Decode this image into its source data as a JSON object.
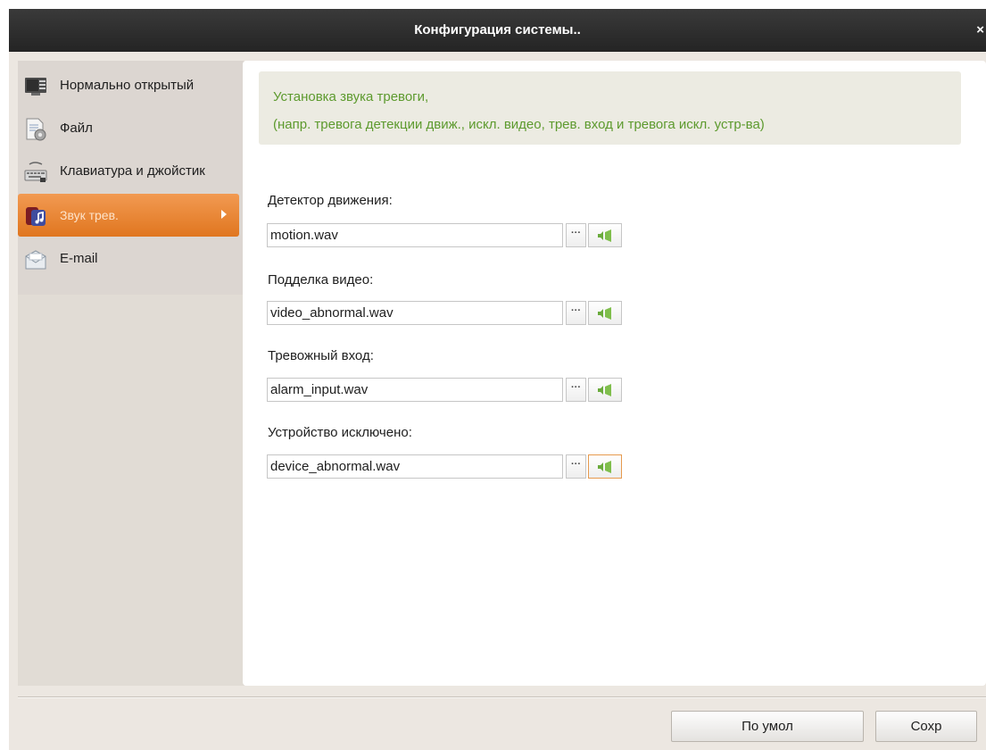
{
  "window": {
    "title": "Конфигурация системы..",
    "close_label": "×"
  },
  "sidebar": {
    "items": [
      {
        "label": "Нормально открытый",
        "icon": "monitor-icon",
        "active": false
      },
      {
        "label": "Файл",
        "icon": "file-settings-icon",
        "active": false
      },
      {
        "label": "Клавиатура и джойстик",
        "icon": "keyboard-icon",
        "active": false
      },
      {
        "label": "Звук трев.",
        "icon": "alarm-sound-icon",
        "active": true
      },
      {
        "label": "E-mail",
        "icon": "email-icon",
        "active": false
      }
    ]
  },
  "main": {
    "notice": {
      "line1": "Установка звука тревоги,",
      "line2": "(напр. тревога детекции движ., искл. видео, трев. вход и тревога искл. устр-ва)"
    },
    "fields": [
      {
        "label": "Детектор движения:",
        "value": "motion.wav"
      },
      {
        "label": "Подделка видео:",
        "value": "video_abnormal.wav"
      },
      {
        "label": "Тревожный вход:",
        "value": "alarm_input.wav"
      },
      {
        "label": "Устройство исключено:",
        "value": "device_abnormal.wav"
      }
    ],
    "browse_label": "···"
  },
  "footer": {
    "default_label": "По умол",
    "save_label": "Сохр"
  },
  "colors": {
    "accent": "#e9842e",
    "notice_text": "#5d9a2e",
    "titlebar": "#2c2c2c"
  }
}
